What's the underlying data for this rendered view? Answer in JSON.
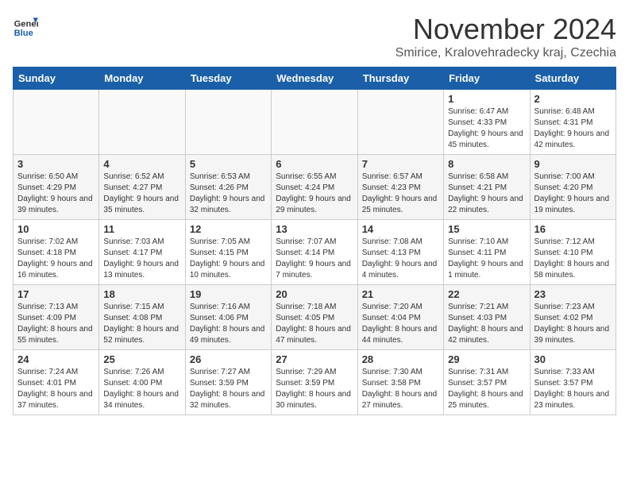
{
  "logo": {
    "general": "General",
    "blue": "Blue"
  },
  "title": "November 2024",
  "location": "Smirice, Kralovehradecky kraj, Czechia",
  "days_of_week": [
    "Sunday",
    "Monday",
    "Tuesday",
    "Wednesday",
    "Thursday",
    "Friday",
    "Saturday"
  ],
  "weeks": [
    [
      {
        "day": "",
        "info": ""
      },
      {
        "day": "",
        "info": ""
      },
      {
        "day": "",
        "info": ""
      },
      {
        "day": "",
        "info": ""
      },
      {
        "day": "",
        "info": ""
      },
      {
        "day": "1",
        "info": "Sunrise: 6:47 AM\nSunset: 4:33 PM\nDaylight: 9 hours and 45 minutes."
      },
      {
        "day": "2",
        "info": "Sunrise: 6:48 AM\nSunset: 4:31 PM\nDaylight: 9 hours and 42 minutes."
      }
    ],
    [
      {
        "day": "3",
        "info": "Sunrise: 6:50 AM\nSunset: 4:29 PM\nDaylight: 9 hours and 39 minutes."
      },
      {
        "day": "4",
        "info": "Sunrise: 6:52 AM\nSunset: 4:27 PM\nDaylight: 9 hours and 35 minutes."
      },
      {
        "day": "5",
        "info": "Sunrise: 6:53 AM\nSunset: 4:26 PM\nDaylight: 9 hours and 32 minutes."
      },
      {
        "day": "6",
        "info": "Sunrise: 6:55 AM\nSunset: 4:24 PM\nDaylight: 9 hours and 29 minutes."
      },
      {
        "day": "7",
        "info": "Sunrise: 6:57 AM\nSunset: 4:23 PM\nDaylight: 9 hours and 25 minutes."
      },
      {
        "day": "8",
        "info": "Sunrise: 6:58 AM\nSunset: 4:21 PM\nDaylight: 9 hours and 22 minutes."
      },
      {
        "day": "9",
        "info": "Sunrise: 7:00 AM\nSunset: 4:20 PM\nDaylight: 9 hours and 19 minutes."
      }
    ],
    [
      {
        "day": "10",
        "info": "Sunrise: 7:02 AM\nSunset: 4:18 PM\nDaylight: 9 hours and 16 minutes."
      },
      {
        "day": "11",
        "info": "Sunrise: 7:03 AM\nSunset: 4:17 PM\nDaylight: 9 hours and 13 minutes."
      },
      {
        "day": "12",
        "info": "Sunrise: 7:05 AM\nSunset: 4:15 PM\nDaylight: 9 hours and 10 minutes."
      },
      {
        "day": "13",
        "info": "Sunrise: 7:07 AM\nSunset: 4:14 PM\nDaylight: 9 hours and 7 minutes."
      },
      {
        "day": "14",
        "info": "Sunrise: 7:08 AM\nSunset: 4:13 PM\nDaylight: 9 hours and 4 minutes."
      },
      {
        "day": "15",
        "info": "Sunrise: 7:10 AM\nSunset: 4:11 PM\nDaylight: 9 hours and 1 minute."
      },
      {
        "day": "16",
        "info": "Sunrise: 7:12 AM\nSunset: 4:10 PM\nDaylight: 8 hours and 58 minutes."
      }
    ],
    [
      {
        "day": "17",
        "info": "Sunrise: 7:13 AM\nSunset: 4:09 PM\nDaylight: 8 hours and 55 minutes."
      },
      {
        "day": "18",
        "info": "Sunrise: 7:15 AM\nSunset: 4:08 PM\nDaylight: 8 hours and 52 minutes."
      },
      {
        "day": "19",
        "info": "Sunrise: 7:16 AM\nSunset: 4:06 PM\nDaylight: 8 hours and 49 minutes."
      },
      {
        "day": "20",
        "info": "Sunrise: 7:18 AM\nSunset: 4:05 PM\nDaylight: 8 hours and 47 minutes."
      },
      {
        "day": "21",
        "info": "Sunrise: 7:20 AM\nSunset: 4:04 PM\nDaylight: 8 hours and 44 minutes."
      },
      {
        "day": "22",
        "info": "Sunrise: 7:21 AM\nSunset: 4:03 PM\nDaylight: 8 hours and 42 minutes."
      },
      {
        "day": "23",
        "info": "Sunrise: 7:23 AM\nSunset: 4:02 PM\nDaylight: 8 hours and 39 minutes."
      }
    ],
    [
      {
        "day": "24",
        "info": "Sunrise: 7:24 AM\nSunset: 4:01 PM\nDaylight: 8 hours and 37 minutes."
      },
      {
        "day": "25",
        "info": "Sunrise: 7:26 AM\nSunset: 4:00 PM\nDaylight: 8 hours and 34 minutes."
      },
      {
        "day": "26",
        "info": "Sunrise: 7:27 AM\nSunset: 3:59 PM\nDaylight: 8 hours and 32 minutes."
      },
      {
        "day": "27",
        "info": "Sunrise: 7:29 AM\nSunset: 3:59 PM\nDaylight: 8 hours and 30 minutes."
      },
      {
        "day": "28",
        "info": "Sunrise: 7:30 AM\nSunset: 3:58 PM\nDaylight: 8 hours and 27 minutes."
      },
      {
        "day": "29",
        "info": "Sunrise: 7:31 AM\nSunset: 3:57 PM\nDaylight: 8 hours and 25 minutes."
      },
      {
        "day": "30",
        "info": "Sunrise: 7:33 AM\nSunset: 3:57 PM\nDaylight: 8 hours and 23 minutes."
      }
    ]
  ]
}
